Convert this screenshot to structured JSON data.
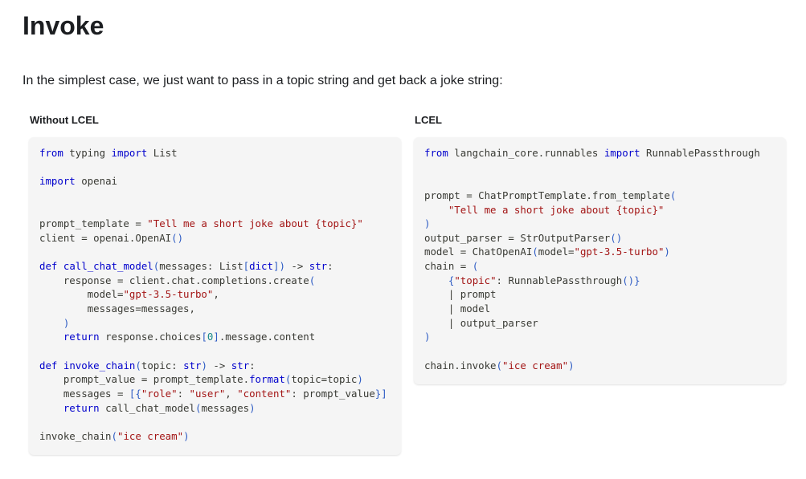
{
  "heading": "Invoke",
  "intro": "In the simplest case, we just want to pass in a topic string and get back a joke string:",
  "columns": {
    "left": {
      "label": "Without LCEL",
      "lines": [
        [
          [
            "kw",
            "from"
          ],
          [
            "plain",
            " typing "
          ],
          [
            "kw",
            "import"
          ],
          [
            "plain",
            " List"
          ]
        ],
        [],
        [
          [
            "kw",
            "import"
          ],
          [
            "plain",
            " openai"
          ]
        ],
        [],
        [],
        [
          [
            "plain",
            "prompt_template = "
          ],
          [
            "str",
            "\"Tell me a short joke about {topic}\""
          ]
        ],
        [
          [
            "plain",
            "client = openai.OpenAI"
          ],
          [
            "blue",
            "()"
          ]
        ],
        [],
        [
          [
            "kw",
            "def"
          ],
          [
            "plain",
            " "
          ],
          [
            "fn",
            "call_chat_model"
          ],
          [
            "blue",
            "("
          ],
          [
            "plain",
            "messages: List"
          ],
          [
            "blue",
            "["
          ],
          [
            "kw",
            "dict"
          ],
          [
            "blue",
            "]"
          ],
          [
            "blue",
            ")"
          ],
          [
            "plain",
            " -> "
          ],
          [
            "kw",
            "str"
          ],
          [
            "plain",
            ":"
          ]
        ],
        [
          [
            "plain",
            "    response = client.chat.completions.create"
          ],
          [
            "blue",
            "("
          ]
        ],
        [
          [
            "plain",
            "        model="
          ],
          [
            "str",
            "\"gpt-3.5-turbo\""
          ],
          [
            "plain",
            ","
          ]
        ],
        [
          [
            "plain",
            "        messages=messages,"
          ]
        ],
        [
          [
            "plain",
            "    "
          ],
          [
            "blue",
            ")"
          ]
        ],
        [
          [
            "plain",
            "    "
          ],
          [
            "kw",
            "return"
          ],
          [
            "plain",
            " response.choices"
          ],
          [
            "blue",
            "["
          ],
          [
            "num",
            "0"
          ],
          [
            "blue",
            "]"
          ],
          [
            "plain",
            ".message.content"
          ]
        ],
        [],
        [
          [
            "kw",
            "def"
          ],
          [
            "plain",
            " "
          ],
          [
            "fn",
            "invoke_chain"
          ],
          [
            "blue",
            "("
          ],
          [
            "plain",
            "topic: "
          ],
          [
            "kw",
            "str"
          ],
          [
            "blue",
            ")"
          ],
          [
            "plain",
            " -> "
          ],
          [
            "kw",
            "str"
          ],
          [
            "plain",
            ":"
          ]
        ],
        [
          [
            "plain",
            "    prompt_value = prompt_template."
          ],
          [
            "fn",
            "format"
          ],
          [
            "blue",
            "("
          ],
          [
            "plain",
            "topic=topic"
          ],
          [
            "blue",
            ")"
          ]
        ],
        [
          [
            "plain",
            "    messages = "
          ],
          [
            "blue",
            "[{"
          ],
          [
            "str",
            "\"role\""
          ],
          [
            "plain",
            ": "
          ],
          [
            "str",
            "\"user\""
          ],
          [
            "plain",
            ", "
          ],
          [
            "str",
            "\"content\""
          ],
          [
            "plain",
            ": prompt_value"
          ],
          [
            "blue",
            "}]"
          ]
        ],
        [
          [
            "plain",
            "    "
          ],
          [
            "kw",
            "return"
          ],
          [
            "plain",
            " call_chat_model"
          ],
          [
            "blue",
            "("
          ],
          [
            "plain",
            "messages"
          ],
          [
            "blue",
            ")"
          ]
        ],
        [],
        [
          [
            "plain",
            "invoke_chain"
          ],
          [
            "blue",
            "("
          ],
          [
            "str",
            "\"ice cream\""
          ],
          [
            "blue",
            ")"
          ]
        ]
      ]
    },
    "right": {
      "label": "LCEL",
      "lines": [
        [
          [
            "kw",
            "from"
          ],
          [
            "plain",
            " langchain_core.runnables "
          ],
          [
            "kw",
            "import"
          ],
          [
            "plain",
            " RunnablePassthrough"
          ]
        ],
        [],
        [],
        [
          [
            "plain",
            "prompt = ChatPromptTemplate.from_template"
          ],
          [
            "blue",
            "("
          ]
        ],
        [
          [
            "plain",
            "    "
          ],
          [
            "str",
            "\"Tell me a short joke about {topic}\""
          ]
        ],
        [
          [
            "blue",
            ")"
          ]
        ],
        [
          [
            "plain",
            "output_parser = StrOutputParser"
          ],
          [
            "blue",
            "()"
          ]
        ],
        [
          [
            "plain",
            "model = ChatOpenAI"
          ],
          [
            "blue",
            "("
          ],
          [
            "plain",
            "model="
          ],
          [
            "str",
            "\"gpt-3.5-turbo\""
          ],
          [
            "blue",
            ")"
          ]
        ],
        [
          [
            "plain",
            "chain = "
          ],
          [
            "blue",
            "("
          ]
        ],
        [
          [
            "plain",
            "    "
          ],
          [
            "blue",
            "{"
          ],
          [
            "str",
            "\"topic\""
          ],
          [
            "plain",
            ": RunnablePassthrough"
          ],
          [
            "blue",
            "()}"
          ]
        ],
        [
          [
            "plain",
            "    | prompt"
          ]
        ],
        [
          [
            "plain",
            "    | model"
          ]
        ],
        [
          [
            "plain",
            "    | output_parser"
          ]
        ],
        [
          [
            "blue",
            ")"
          ]
        ],
        [],
        [
          [
            "plain",
            "chain.invoke"
          ],
          [
            "blue",
            "("
          ],
          [
            "str",
            "\"ice cream\""
          ],
          [
            "blue",
            ")"
          ]
        ]
      ]
    }
  },
  "colors": {
    "keyword": "#0000cc",
    "string": "#a31515",
    "number": "#1a8a8a",
    "bracket": "#2e5cc4",
    "code_background": "#f5f5f5"
  }
}
